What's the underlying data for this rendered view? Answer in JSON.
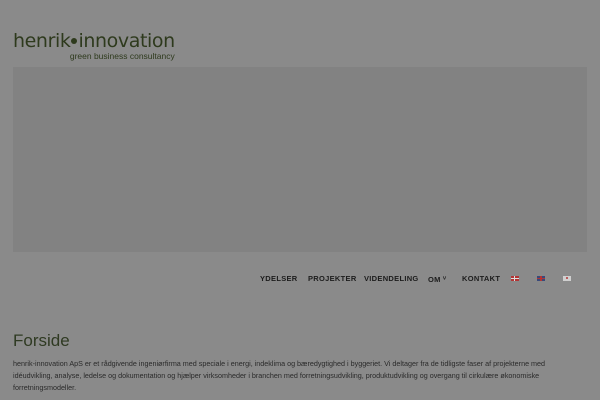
{
  "logo": {
    "left": "henrik",
    "right": "innovation",
    "tagline": "green business consultancy"
  },
  "nav": {
    "items": [
      {
        "label": "YDELSER"
      },
      {
        "label": "PROJEKTER"
      },
      {
        "label": "VIDENDELING"
      },
      {
        "label": "OM",
        "caret": "˅"
      },
      {
        "label": "KONTAKT"
      }
    ],
    "languages": [
      "Danish flag",
      "English flag",
      "Japanese flag"
    ]
  },
  "page": {
    "title": "Forside",
    "intro": "henrik-innovation ApS er et rådgivende ingeniørfirma med speciale i energi, indeklima og bæredygtighed i byggeriet. Vi deltager fra de tidligste faser af projekterne med idéudvikling, analyse, ledelse og dokumentation og hjælper virksomheder i branchen med forretningsudvikling, produktudvikling og overgang til cirkulære økonomiske forretningsmodeller."
  }
}
